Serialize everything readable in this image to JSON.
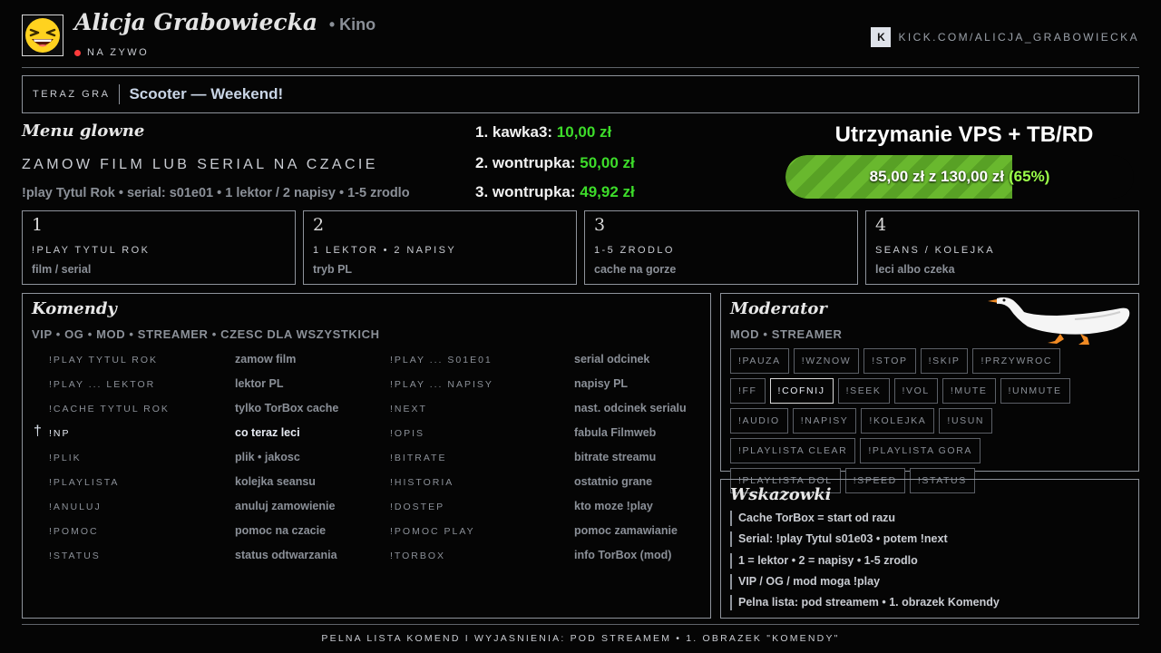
{
  "header": {
    "name": "Alicja Grabowiecka",
    "suffix": "• Kino",
    "live": "NA ZYWO",
    "kick_letter": "K",
    "kick_url": "KICK.COM/ALICJA_GRABOWIECKA"
  },
  "now_playing": {
    "label": "TERAZ GRA",
    "song": "Scooter — Weekend!"
  },
  "menu": {
    "head": "Menu glowne",
    "title": "ZAMOW FILM LUB SERIAL NA CZACIE",
    "subtitle": "!play Tytul Rok • serial: s01e01 • 1 lektor / 2 napisy • 1-5 zrodlo"
  },
  "donors": [
    {
      "label": "1. kawka3:",
      "amount": "10,00 zł"
    },
    {
      "label": "2. wontrupka:",
      "amount": "50,00 zł"
    },
    {
      "label": "3. wontrupka:",
      "amount": "49,92 zł"
    }
  ],
  "goal": {
    "title": "Utrzymanie VPS + TB/RD",
    "progress_text": "85,00 zł z 130,00 zł",
    "percent_text": "(65%)",
    "fraction": 0.65,
    "colors": {
      "fill": "#69b82e",
      "percent": "#9cff4a"
    }
  },
  "steps": [
    {
      "num": "1",
      "label": "!PLAY TYTUL ROK",
      "sub": "film / serial"
    },
    {
      "num": "2",
      "label": "1 LEKTOR • 2 NAPISY",
      "sub": "tryb PL"
    },
    {
      "num": "3",
      "label": "1-5 ZRODLO",
      "sub": "cache na gorze"
    },
    {
      "num": "4",
      "label": "SEANS / KOLEJKA",
      "sub": "leci albo czeka"
    }
  ],
  "commands": {
    "head": "Komendy",
    "roles": "VIP • OG • MOD • STREAMER • CZESC DLA WSZYSTKICH",
    "rows": [
      {
        "cmd1": "!PLAY TYTUL ROK",
        "desc1": "zamow film",
        "cmd2": "!PLAY ... S01E01",
        "desc2": "serial odcinek"
      },
      {
        "cmd1": "!PLAY ... LEKTOR",
        "desc1": "lektor PL",
        "cmd2": "!PLAY ... NAPISY",
        "desc2": "napisy PL"
      },
      {
        "cmd1": "!CACHE TYTUL ROK",
        "desc1": "tylko TorBox cache",
        "cmd2": "!NEXT",
        "desc2": "nast. odcinek serialu"
      },
      {
        "marker": "†",
        "cmd1": "!NP",
        "desc1": "co teraz leci",
        "cmd2": "!OPIS",
        "desc2": "fabula Filmweb"
      },
      {
        "cmd1": "!PLIK",
        "desc1": "plik • jakosc",
        "cmd2": "!BITRATE",
        "desc2": "bitrate streamu"
      },
      {
        "cmd1": "!PLAYLISTA",
        "desc1": "kolejka seansu",
        "cmd2": "!HISTORIA",
        "desc2": "ostatnio grane"
      },
      {
        "cmd1": "!ANULUJ",
        "desc1": "anuluj zamowienie",
        "cmd2": "!DOSTEP",
        "desc2": "kto moze !play"
      },
      {
        "cmd1": "!POMOC",
        "desc1": "pomoc na czacie",
        "cmd2": "!POMOC PLAY",
        "desc2": "pomoc zamawianie"
      },
      {
        "cmd1": "!STATUS",
        "desc1": "status odtwarzania",
        "cmd2": "!TORBOX",
        "desc2": "info TorBox (mod)"
      }
    ]
  },
  "moderator": {
    "head": "Moderator",
    "roles": "MOD • STREAMER",
    "buttons": [
      "!PAUZA",
      "!WZNOW",
      "!STOP",
      "!SKIP",
      "!PRZYWROC",
      "!FF",
      "!COFNIJ",
      "!SEEK",
      "!VOL",
      "!MUTE",
      "!UNMUTE",
      "!AUDIO",
      "!NAPISY",
      "!KOLEJKA",
      "!USUN",
      "!PLAYLISTA CLEAR",
      "!PLAYLISTA GORA",
      "!PLAYLISTA DOL",
      "!SPEED",
      "!STATUS"
    ]
  },
  "tips": {
    "head": "Wskazowki",
    "items": [
      "Cache TorBox = start od razu",
      "Serial: !play Tytul s01e03 • potem !next",
      "1 = lektor • 2 = napisy • 1-5 zrodlo",
      "VIP / OG / mod moga !play",
      "Pelna lista: pod streamem • 1. obrazek Komendy"
    ]
  },
  "footer": "PELNA LISTA KOMEND I WYJASNIENIA: POD STREAMEM • 1. OBRAZEK \"KOMENDY\""
}
